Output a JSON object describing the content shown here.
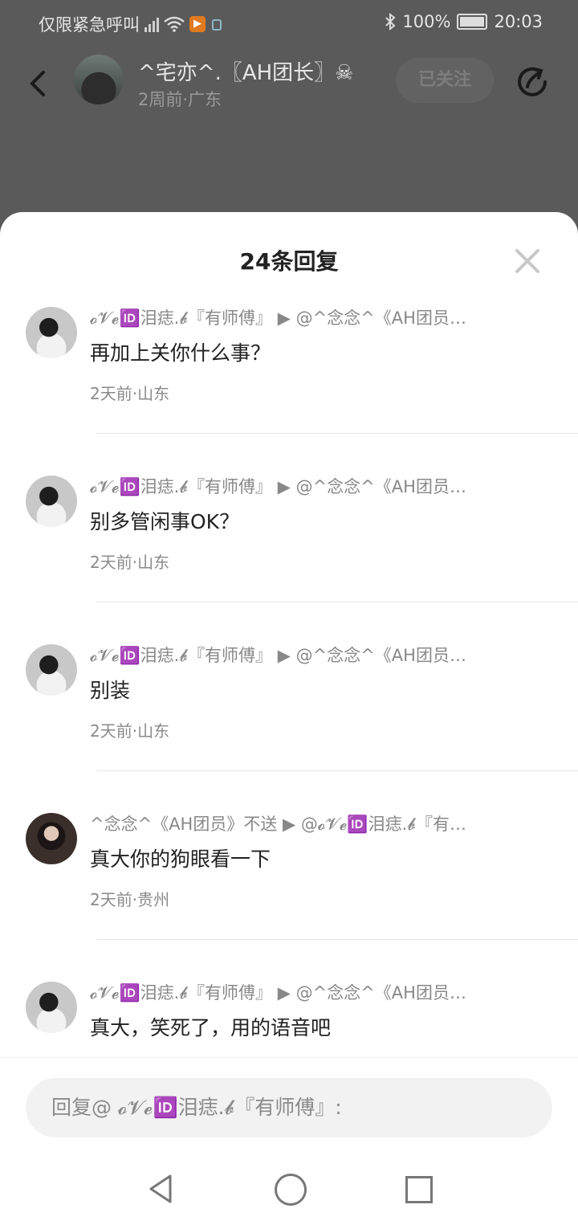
{
  "status_bar": {
    "carrier": "仅限紧急呼叫",
    "battery": "100%",
    "time": "20:03"
  },
  "header": {
    "author_name": "^宅亦^.〖AH团长〗☠",
    "meta": "2周前·广东",
    "follow_label": "已关注"
  },
  "sheet": {
    "title": "24条回复"
  },
  "replies": [
    {
      "author": "𝓸𝓥𝓮🆔泪痣.𝓫『有师傅』",
      "target": "@^念念^《AH团员…",
      "content": "再加上关你什么事？",
      "time": "2天前",
      "location": "山东"
    },
    {
      "author": "𝓸𝓥𝓮🆔泪痣.𝓫『有师傅』",
      "target": "@^念念^《AH团员…",
      "content": "别多管闲事OK？",
      "time": "2天前",
      "location": "山东"
    },
    {
      "author": "𝓸𝓥𝓮🆔泪痣.𝓫『有师傅』",
      "target": "@^念念^《AH团员…",
      "content": "别装",
      "time": "2天前",
      "location": "山东"
    },
    {
      "author": "^念念^《AH团员》不送",
      "target": "@𝓸𝓥𝓮🆔泪痣.𝓫『有…",
      "content": "真大你的狗眼看一下",
      "time": "2天前",
      "location": "贵州"
    },
    {
      "author": "𝓸𝓥𝓮🆔泪痣.𝓫『有师傅』",
      "target": "@^念念^《AH团员…",
      "content": "真大，笑死了，用的语音吧",
      "time": "",
      "location": ""
    }
  ],
  "composer": {
    "placeholder": "回复@ 𝓸𝓥𝓮🆔泪痣.𝓫『有师傅』:"
  },
  "separator": "·",
  "arrow": "▶"
}
